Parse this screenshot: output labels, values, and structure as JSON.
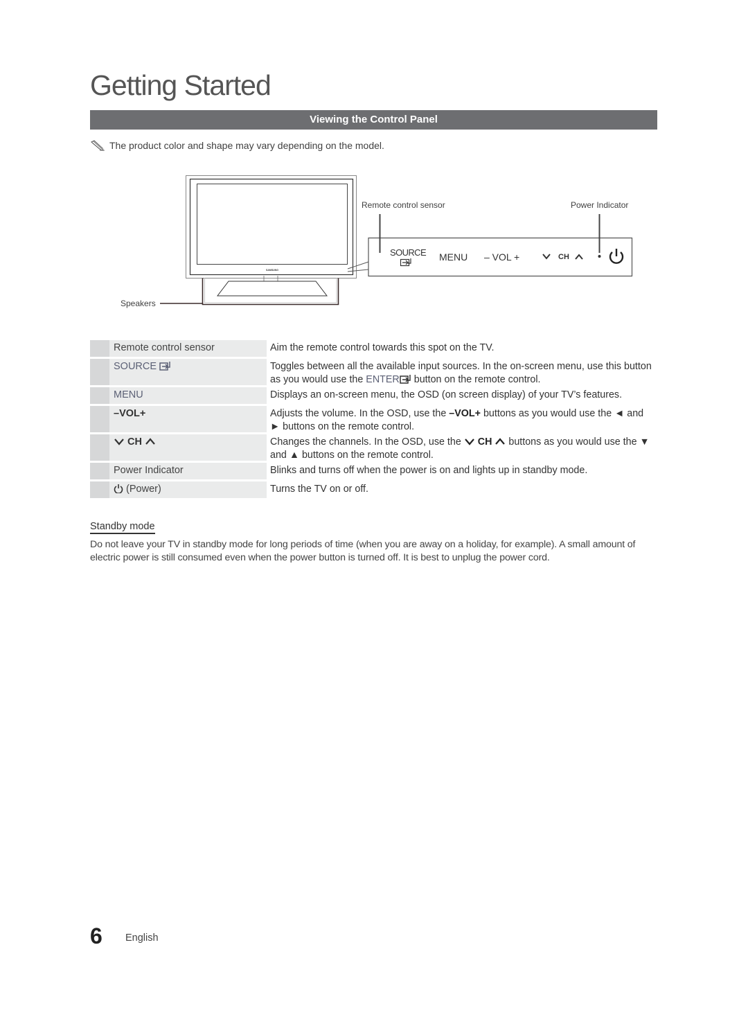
{
  "page": {
    "title": "Getting Started",
    "section_title": "Viewing the Control Panel",
    "note": "The product color and shape may vary depending on the model."
  },
  "diagram": {
    "labels": {
      "remote_sensor": "Remote control sensor",
      "power_indicator": "Power Indicator",
      "speakers": "Speakers"
    },
    "tv_logo": "SAMSUNG",
    "panel_buttons": {
      "source": "SOURCE",
      "menu": "MENU",
      "vol": "–  VOL  +",
      "ch": "CH"
    }
  },
  "table": {
    "rows": [
      {
        "key": "Remote control sensor",
        "desc": "Aim the remote control towards this spot on the TV."
      },
      {
        "key": "SOURCE",
        "desc_a": "Toggles between all the available input sources. In the on-screen menu, use this button as you would use the ",
        "desc_enter": "ENTER",
        "desc_b": " button on the remote control."
      },
      {
        "key": "MENU",
        "desc": "Displays an on-screen menu, the OSD (on screen display) of your TV’s features."
      },
      {
        "key": "–VOL+",
        "desc_a": "Adjusts the volume. In the OSD, use the ",
        "desc_vol": "–VOL+",
        "desc_b": " buttons as you would use the ◄ and ► buttons on the remote control."
      },
      {
        "key": "CH",
        "desc_a": "Changes the channels. In the OSD, use the ",
        "desc_ch": "CH",
        "desc_b": " buttons as you would use the ▼ and ▲ buttons on the remote control."
      },
      {
        "key": "Power Indicator",
        "desc": "Blinks and turns off when the power is on and lights up in standby mode."
      },
      {
        "key": "(Power)",
        "desc": "Turns the TV on or off."
      }
    ]
  },
  "standby": {
    "title": "Standby mode",
    "body": "Do not leave your TV in standby mode for long periods of time (when you are away on a holiday, for example). A small amount of electric power is still consumed even when the power button is turned off. It is best to unplug the power cord."
  },
  "footer": {
    "page_number": "6",
    "language": "English"
  },
  "colors": {
    "section_bar": "#6d6e71",
    "accent_text": "#5b6075",
    "marker_cell": "#d6d7d8",
    "key_cell": "#eaebeb"
  }
}
